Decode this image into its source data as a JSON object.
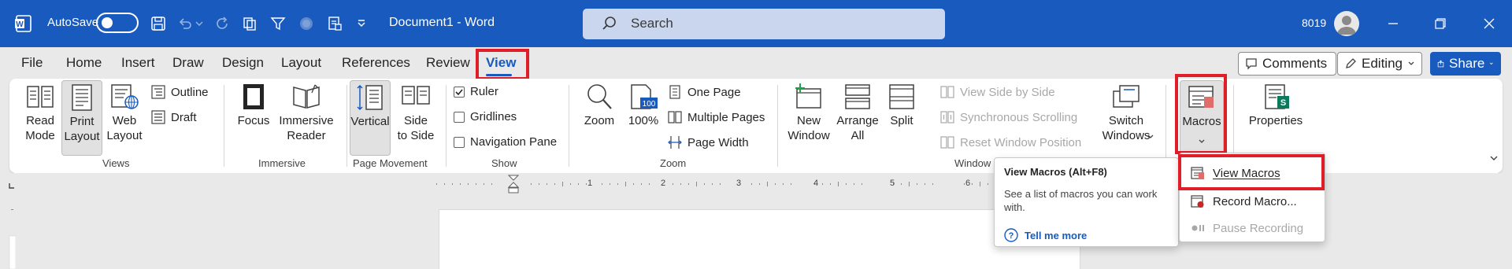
{
  "titlebar": {
    "autosave_label": "AutoSave",
    "document_title": "Document1  -  Word",
    "search_placeholder": "Search",
    "user_id": "8019",
    "brand_color": "#185abd"
  },
  "tabs": [
    {
      "label": "File"
    },
    {
      "label": "Home"
    },
    {
      "label": "Insert"
    },
    {
      "label": "Draw"
    },
    {
      "label": "Design"
    },
    {
      "label": "Layout"
    },
    {
      "label": "References"
    },
    {
      "label": "Review"
    },
    {
      "label": "View",
      "active": true
    }
  ],
  "right_buttons": {
    "comments": "Comments",
    "editing": "Editing",
    "share": "Share"
  },
  "ribbon": {
    "views": {
      "read_mode": "Read\nMode",
      "print_layout": "Print\nLayout",
      "web_layout": "Web\nLayout",
      "outline": "Outline",
      "draft": "Draft",
      "label": "Views"
    },
    "immersive": {
      "focus": "Focus",
      "immersive_reader": "Immersive\nReader",
      "label": "Immersive"
    },
    "page_movement": {
      "vertical": "Vertical",
      "side_to_side": "Side\nto Side",
      "label": "Page Movement"
    },
    "show": {
      "ruler": "Ruler",
      "gridlines": "Gridlines",
      "navigation_pane": "Navigation Pane",
      "ruler_checked": true,
      "gridlines_checked": false,
      "navigation_pane_checked": false,
      "label": "Show"
    },
    "zoom": {
      "zoom": "Zoom",
      "hundred": "100%",
      "one_page": "One Page",
      "multiple_pages": "Multiple Pages",
      "page_width": "Page Width",
      "label": "Zoom"
    },
    "window": {
      "new_window": "New\nWindow",
      "arrange_all": "Arrange\nAll",
      "split": "Split",
      "view_side_by_side": "View Side by Side",
      "sync_scrolling": "Synchronous Scrolling",
      "reset_window_position": "Reset Window Position",
      "switch_windows": "Switch\nWindows",
      "label": "Window"
    },
    "macros": {
      "label": "Macros"
    },
    "properties": {
      "label": "Properties"
    }
  },
  "ruler_numbers": [
    "1",
    "2",
    "3",
    "4",
    "5",
    "6"
  ],
  "tooltip": {
    "title": "View Macros (Alt+F8)",
    "description": "See a list of macros you can work with.",
    "tell_me_more": "Tell me more"
  },
  "macros_menu": {
    "items": [
      {
        "label": "View Macros",
        "enabled": true
      },
      {
        "label": "Record Macro...",
        "enabled": true
      },
      {
        "label": "Pause Recording",
        "enabled": false
      }
    ]
  },
  "highlight_color": "#e01e2a"
}
